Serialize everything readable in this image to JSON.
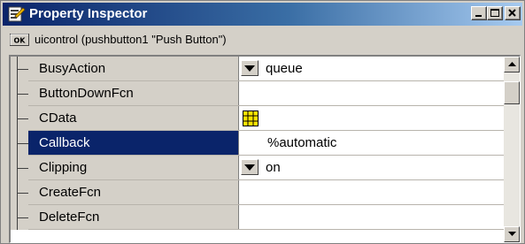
{
  "window": {
    "title": "Property Inspector",
    "icons": {
      "app": "property-inspector-icon",
      "minimize": "minimize-icon",
      "maximize": "maximize-icon",
      "close": "close-icon"
    }
  },
  "object_header": {
    "icon": "ok-button-icon",
    "icon_text": "OK",
    "text": "uicontrol (pushbutton1 \"Push Button\")"
  },
  "properties": [
    {
      "name": "BusyAction",
      "value": "queue",
      "editor": "dropdown"
    },
    {
      "name": "ButtonDownFcn",
      "value": "",
      "editor": "none"
    },
    {
      "name": "CData",
      "value": "",
      "editor": "grid-icon"
    },
    {
      "name": "Callback",
      "value": "%automatic",
      "editor": "text",
      "selected": true
    },
    {
      "name": "Clipping",
      "value": "on",
      "editor": "dropdown"
    },
    {
      "name": "CreateFcn",
      "value": "",
      "editor": "none"
    },
    {
      "name": "DeleteFcn",
      "value": "",
      "editor": "none"
    }
  ],
  "colors": {
    "title_gradient_start": "#0a246a",
    "title_gradient_end": "#a6caf0",
    "selection": "#0a246a",
    "face": "#d4d0c8"
  }
}
